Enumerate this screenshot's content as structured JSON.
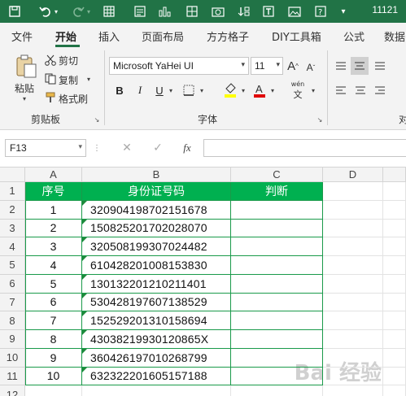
{
  "titlebar": {
    "title": "11121"
  },
  "tabs": [
    "文件",
    "开始",
    "插入",
    "页面布局",
    "方方格子",
    "DIY工具箱",
    "公式",
    "数据"
  ],
  "ribbon": {
    "clipboard": {
      "paste": "粘贴",
      "cut": "剪切",
      "copy": "复制",
      "format_painter": "格式刷",
      "group": "剪贴板"
    },
    "font": {
      "name": "Microsoft YaHei UI",
      "size": "11",
      "group": "字体",
      "phonetic": "wén"
    },
    "next_group": "对"
  },
  "formula_bar": {
    "cell_ref": "F13",
    "formula": ""
  },
  "sheet": {
    "columns": [
      "A",
      "B",
      "C",
      "D"
    ],
    "rows": [
      "1",
      "2",
      "3",
      "4",
      "5",
      "6",
      "7",
      "8",
      "9",
      "10",
      "11",
      "12"
    ],
    "headers": [
      "序号",
      "身份证号码",
      "判断"
    ],
    "data": [
      [
        "1",
        "320904198702151678"
      ],
      [
        "2",
        "150825201702028070"
      ],
      [
        "3",
        "320508199307024482"
      ],
      [
        "4",
        "610428201008153830"
      ],
      [
        "5",
        "130132201210211401"
      ],
      [
        "6",
        "530428197607138529"
      ],
      [
        "7",
        "152529201310158694"
      ],
      [
        "8",
        "43038219930120865X"
      ],
      [
        "9",
        "360426197010268799"
      ],
      [
        "10",
        "632322201605157188"
      ]
    ]
  },
  "watermark": "Bai 经验"
}
